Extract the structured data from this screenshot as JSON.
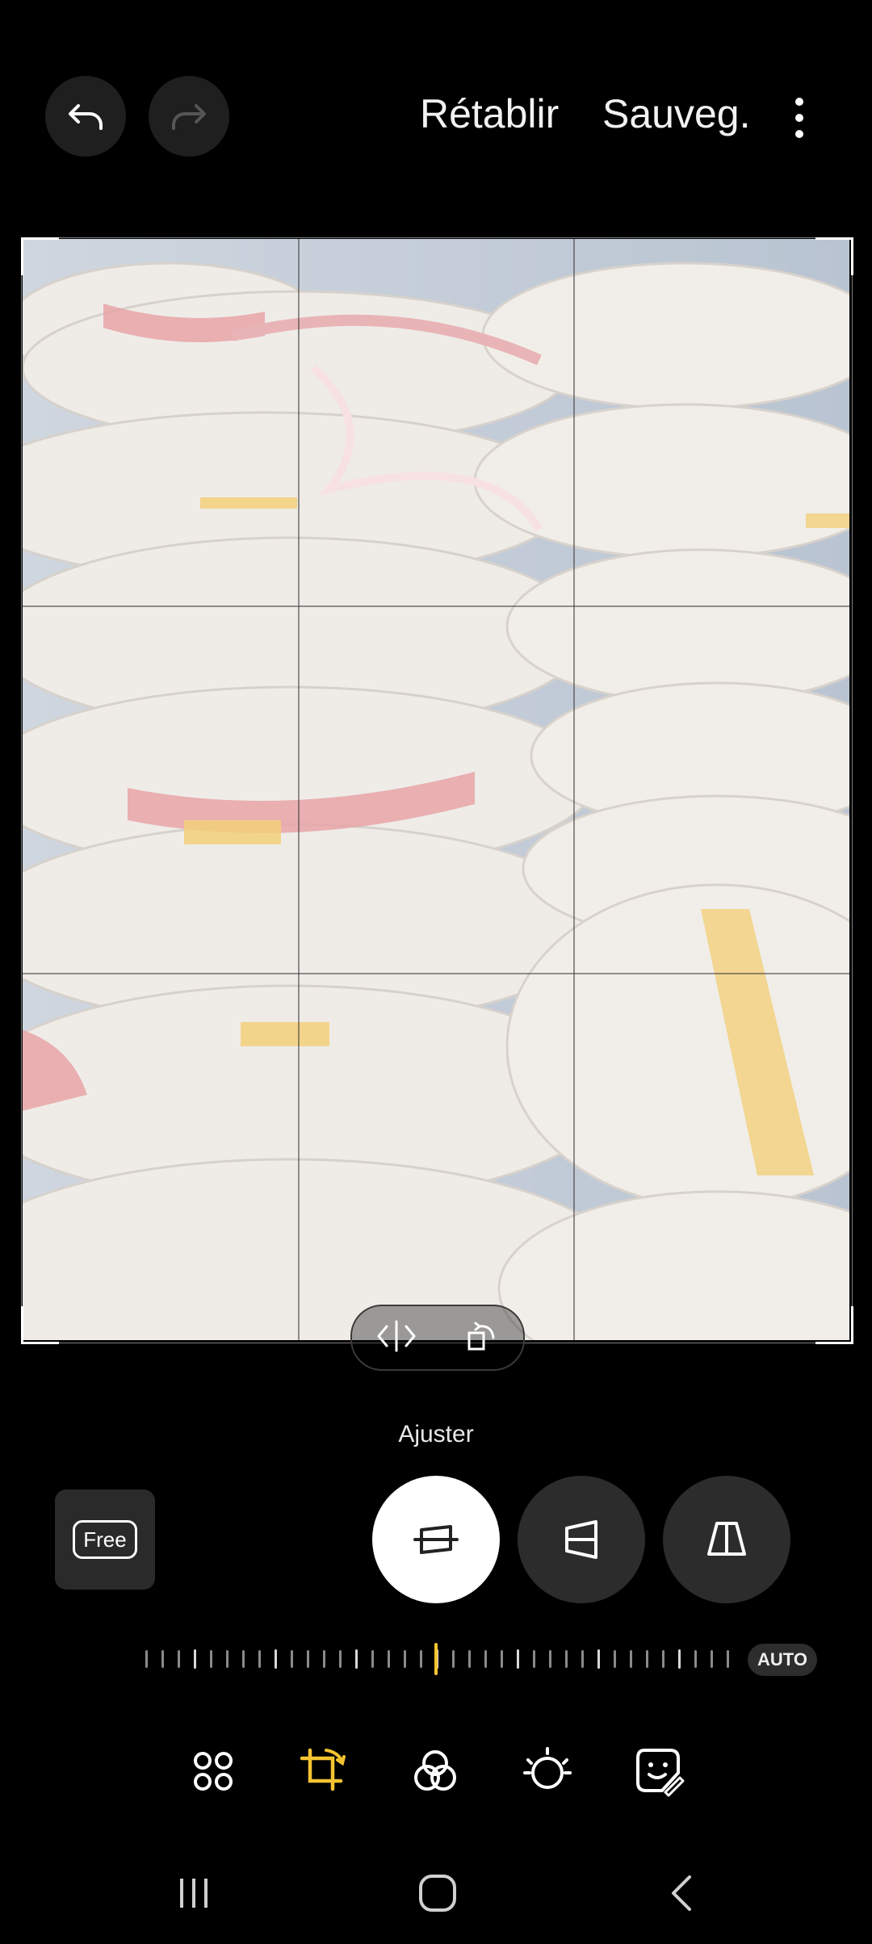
{
  "header": {
    "undo_icon": "undo-icon",
    "redo_icon": "redo-icon",
    "reset_label": "Rétablir",
    "save_label": "Sauveg.",
    "more_icon": "more-vertical-icon"
  },
  "editor": {
    "image_description_icon": "photo-canvas",
    "mirror_icon": "flip-horizontal-icon",
    "rotate_icon": "rotate-icon",
    "mode_label": "Ajuster",
    "ratio_label": "Free",
    "modes": [
      "straighten-icon",
      "vertical-perspective-icon",
      "horizontal-perspective-icon"
    ],
    "slider_auto_label": "AUTO",
    "slider_value": 0
  },
  "toolbar": {
    "items": [
      "grid-apps-icon",
      "crop-rotate-icon",
      "filters-icon",
      "brightness-icon",
      "sticker-icon"
    ],
    "active_color": "#f4c430"
  },
  "navbar": {
    "items": [
      "recent-apps-icon",
      "home-icon",
      "back-icon"
    ]
  }
}
